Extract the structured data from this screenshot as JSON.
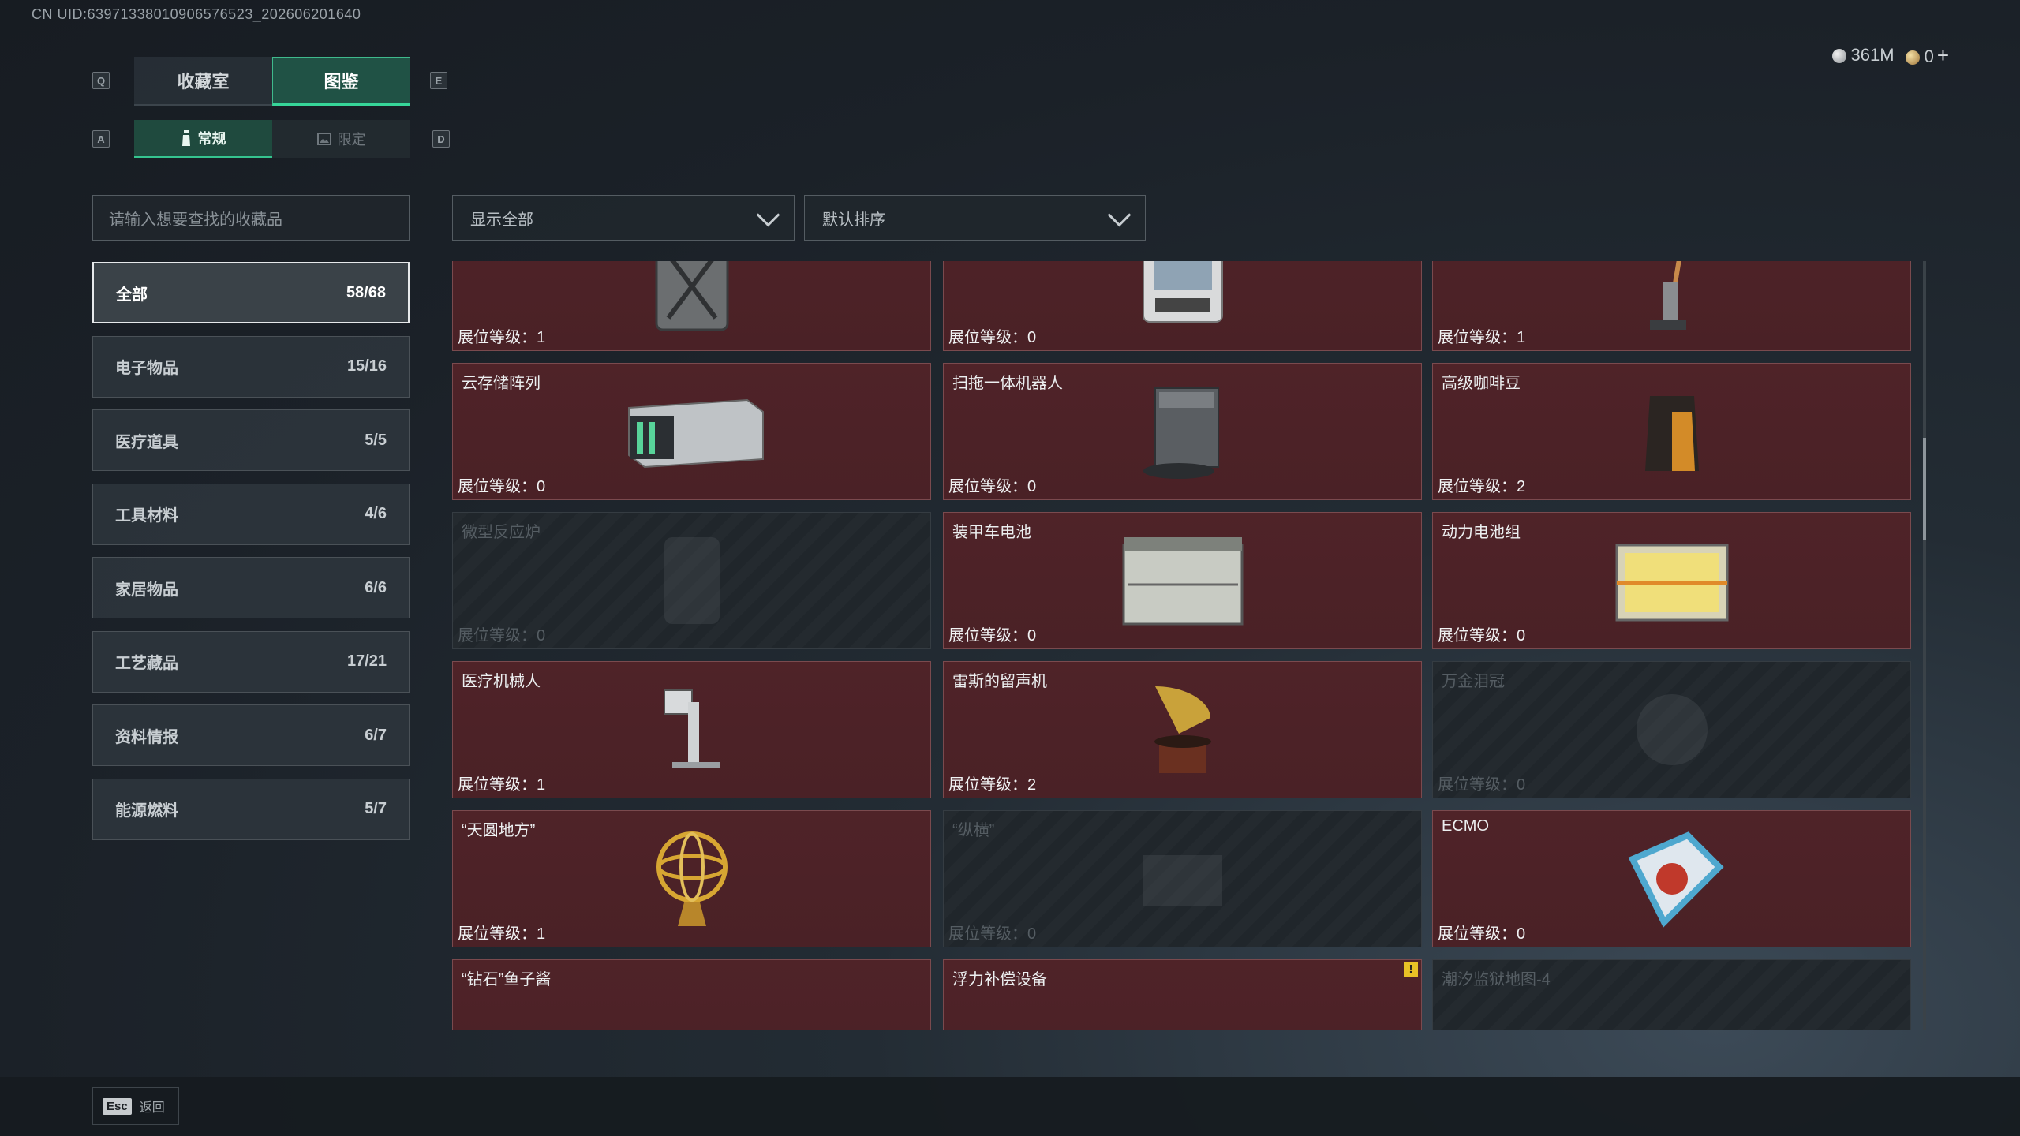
{
  "uid": "CN UID:63971338010906576523_202606201640",
  "keys": {
    "q": "Q",
    "e": "E",
    "a": "A",
    "d": "D"
  },
  "tabs": [
    "收藏室",
    "图鉴"
  ],
  "subtabs": [
    "常规",
    "限定"
  ],
  "currency": {
    "silver": "361M",
    "gold": "0",
    "add": "+"
  },
  "search_placeholder": "请输入想要查找的收藏品",
  "filter": "显示全部",
  "sort": "默认排序",
  "categories": [
    {
      "label": "全部",
      "count": "58/68"
    },
    {
      "label": "电子物品",
      "count": "15/16"
    },
    {
      "label": "医疗道具",
      "count": "5/5"
    },
    {
      "label": "工具材料",
      "count": "4/6"
    },
    {
      "label": "家居物品",
      "count": "6/6"
    },
    {
      "label": "工艺藏品",
      "count": "17/21"
    },
    {
      "label": "资料情报",
      "count": "6/7"
    },
    {
      "label": "能源燃料",
      "count": "5/7"
    }
  ],
  "items": [
    {
      "name": "",
      "level": "展位等级：1",
      "icon": "jerrycan-icon",
      "locked": false
    },
    {
      "name": "",
      "level": "展位等级：0",
      "icon": "terminal-device-icon",
      "locked": false
    },
    {
      "name": "",
      "level": "展位等级：1",
      "icon": "vacuum-cleaner-icon",
      "locked": false
    },
    {
      "name": "云存储阵列",
      "level": "展位等级：0",
      "icon": "storage-array-icon",
      "locked": false
    },
    {
      "name": "扫拖一体机器人",
      "level": "展位等级：0",
      "icon": "robot-vacuum-icon",
      "locked": false
    },
    {
      "name": "高级咖啡豆",
      "level": "展位等级：2",
      "icon": "coffee-bag-icon",
      "locked": false
    },
    {
      "name": "微型反应炉",
      "level": "展位等级：0",
      "icon": "reactor-icon",
      "locked": true
    },
    {
      "name": "装甲车电池",
      "level": "展位等级：0",
      "icon": "car-battery-icon",
      "locked": false
    },
    {
      "name": "动力电池组",
      "level": "展位等级：0",
      "icon": "battery-pack-icon",
      "locked": false
    },
    {
      "name": "医疗机械人",
      "level": "展位等级：1",
      "icon": "medical-robot-icon",
      "locked": false
    },
    {
      "name": "雷斯的留声机",
      "level": "展位等级：2",
      "icon": "gramophone-icon",
      "locked": false
    },
    {
      "name": "万金泪冠",
      "level": "展位等级：0",
      "icon": "crown-icon",
      "locked": true
    },
    {
      "name": "“天圆地方”",
      "level": "展位等级：1",
      "icon": "armillary-sphere-icon",
      "locked": false
    },
    {
      "name": "“纵横”",
      "level": "展位等级：0",
      "icon": "chest-icon",
      "locked": true
    },
    {
      "name": "ECMO",
      "level": "展位等级：0",
      "icon": "ecmo-machine-icon",
      "locked": false
    },
    {
      "name": "“钻石”鱼子酱",
      "level": "",
      "icon": "caviar-tin-icon",
      "locked": false
    },
    {
      "name": "浮力补偿设备",
      "level": "",
      "icon": "bcd-vest-icon",
      "locked": false,
      "alert": "!"
    },
    {
      "name": "潮汐监狱地图-4",
      "level": "",
      "icon": "map-icon",
      "locked": true
    }
  ],
  "back": {
    "key": "Esc",
    "label": "返回"
  },
  "colors": {
    "accent": "#36d699",
    "card_owned": "#4f2328",
    "card_locked": "#242a2f",
    "alert": "#e8c126"
  }
}
